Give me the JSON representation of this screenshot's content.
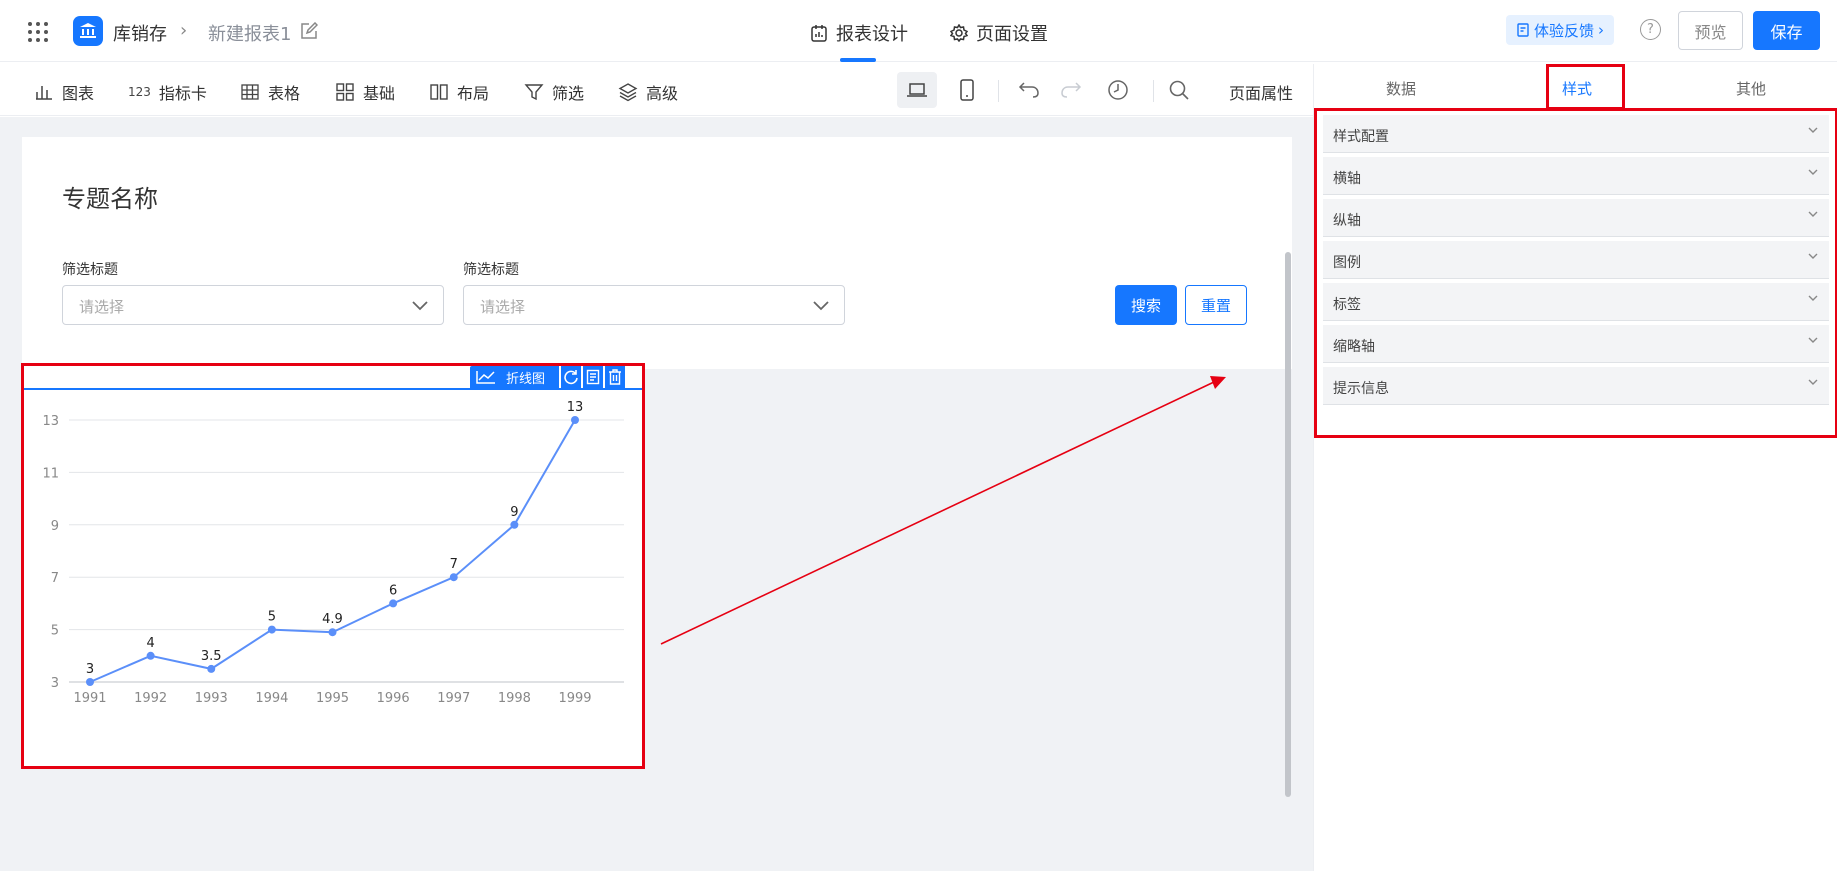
{
  "header": {
    "app_name": "库销存",
    "breadcrumb_sep": "›",
    "report_name": "新建报表1",
    "tabs": [
      {
        "label": "报表设计",
        "active": true
      },
      {
        "label": "页面设置",
        "active": false
      }
    ],
    "feedback": "体验反馈",
    "help": "?",
    "preview": "预览",
    "save": "保存"
  },
  "toolbar": {
    "items": [
      "图表",
      "指标卡",
      "表格",
      "基础",
      "布局",
      "筛选",
      "高级"
    ],
    "page_attr": "页面属性"
  },
  "page": {
    "title": "专题名称",
    "filters": [
      {
        "label": "筛选标题",
        "placeholder": "请选择"
      },
      {
        "label": "筛选标题",
        "placeholder": "请选择"
      }
    ],
    "search": "搜索",
    "reset": "重置"
  },
  "chart_widget": {
    "type_label": "折线图"
  },
  "chart_data": {
    "type": "line",
    "categories": [
      "1991",
      "1992",
      "1993",
      "1994",
      "1995",
      "1996",
      "1997",
      "1998",
      "1999"
    ],
    "values": [
      3,
      4,
      3.5,
      5,
      4.9,
      6,
      7,
      9,
      13
    ],
    "data_labels": [
      "3",
      "4",
      "3.5",
      "5",
      "4.9",
      "6",
      "7",
      "9",
      "13"
    ],
    "yticks": [
      3,
      5,
      7,
      9,
      11,
      13
    ],
    "ylim": [
      3,
      13
    ],
    "grid": true,
    "color": "#5b8ff9"
  },
  "panel": {
    "tabs": [
      {
        "label": "数据",
        "active": false
      },
      {
        "label": "样式",
        "active": true
      },
      {
        "label": "其他",
        "active": false
      }
    ],
    "sections": [
      "样式配置",
      "横轴",
      "纵轴",
      "图例",
      "标签",
      "缩略轴",
      "提示信息"
    ]
  },
  "colors": {
    "primary": "#1677ff",
    "highlight": "#e60012"
  }
}
